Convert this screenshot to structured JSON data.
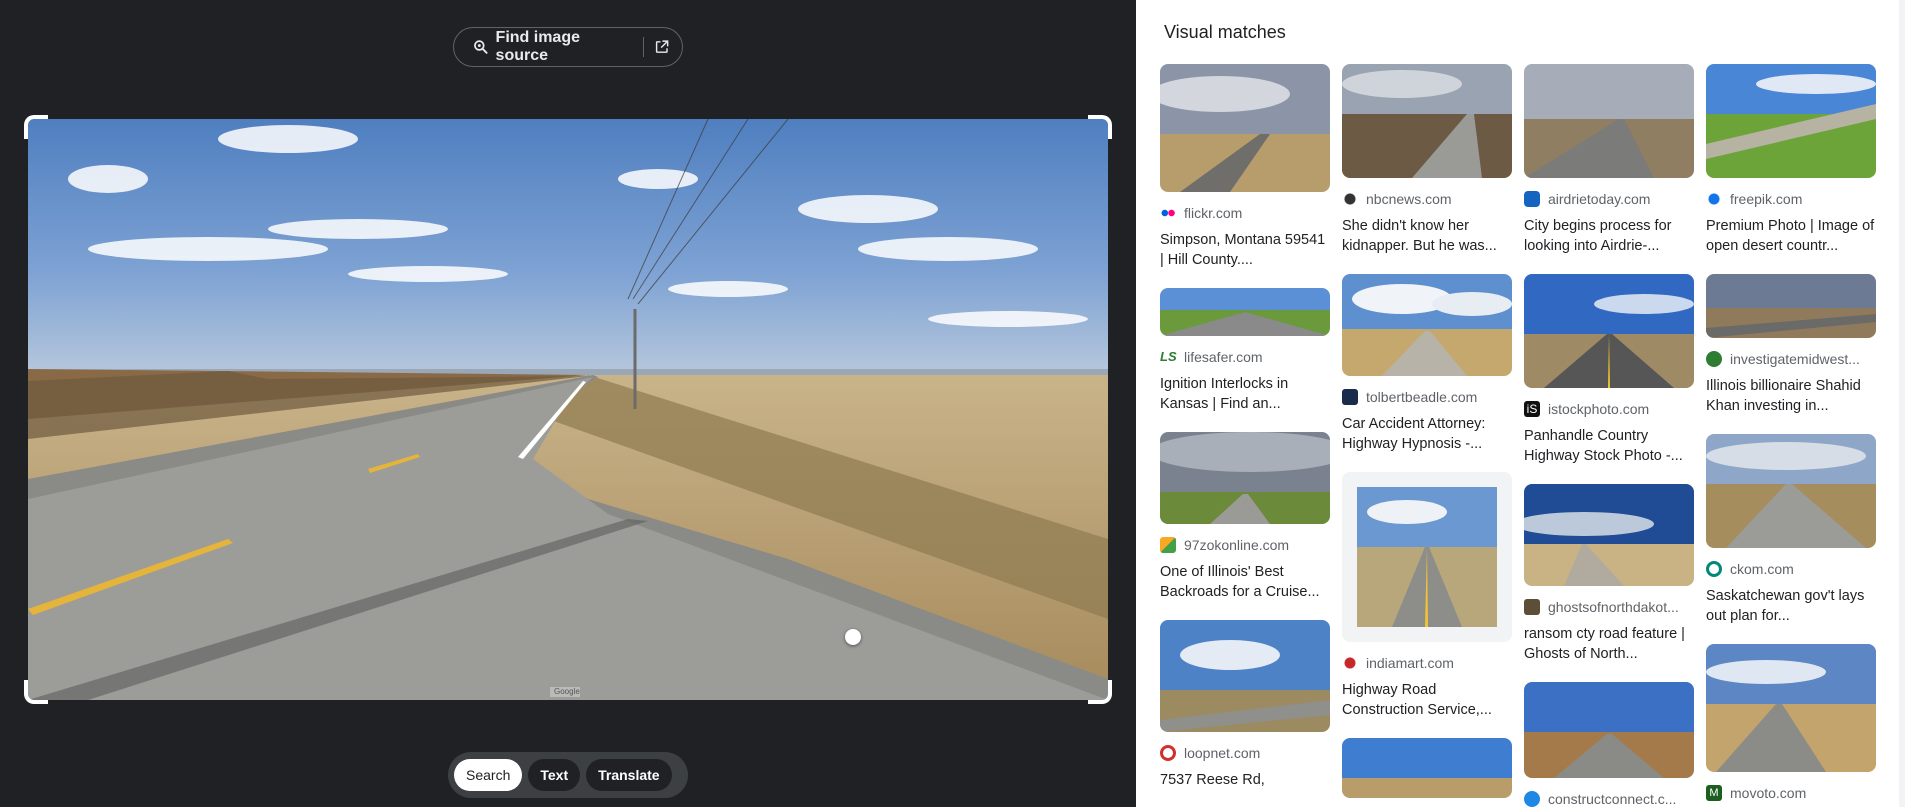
{
  "toolbar": {
    "find_source_label": "Find image source"
  },
  "modes": [
    {
      "label": "Search",
      "active": true
    },
    {
      "label": "Text",
      "active": false
    },
    {
      "label": "Translate",
      "active": false
    }
  ],
  "photo": {
    "watermark": "Google"
  },
  "results": {
    "title": "Visual matches",
    "items": [
      {
        "source": "flickr.com",
        "caption": "Simpson, Montana 59541 | Hill County...."
      },
      {
        "source": "nbcnews.com",
        "caption": "She didn't know her kidnapper. But he was..."
      },
      {
        "source": "airdrietoday.com",
        "caption": "City begins process for looking into Airdrie-..."
      },
      {
        "source": "freepik.com",
        "caption": "Premium Photo | Image of open desert countr..."
      },
      {
        "source": "lifesafer.com",
        "caption": "Ignition Interlocks in Kansas | Find an..."
      },
      {
        "source": "tolbertbeadle.com",
        "caption": "Car Accident Attorney: Highway Hypnosis -..."
      },
      {
        "source": "istockphoto.com",
        "caption": "Panhandle Country Highway Stock Photo -..."
      },
      {
        "source": "investigatemidwest...",
        "caption": "Illinois billionaire Shahid Khan investing in..."
      },
      {
        "source": "97zokonline.com",
        "caption": "One of Illinois' Best Backroads for a Cruise..."
      },
      {
        "source": "indiamart.com",
        "caption": "Highway Road Construction Service,..."
      },
      {
        "source": "ghostsofnorthdakot...",
        "caption": "ransom cty road feature | Ghosts of North..."
      },
      {
        "source": "ckom.com",
        "caption": "Saskatchewan gov't lays out plan for..."
      },
      {
        "source": "loopnet.com",
        "caption": "7537 Reese Rd,"
      },
      {
        "source": "constructconnect.c...",
        "caption": ""
      },
      {
        "source": "movoto.com",
        "caption": ""
      }
    ]
  }
}
